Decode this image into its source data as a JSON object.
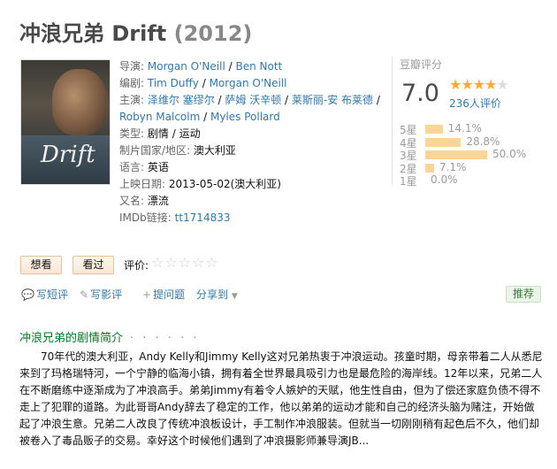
{
  "header": {
    "title": "冲浪兄弟 Drift",
    "year": "(2012)"
  },
  "poster": {
    "logo_text": "Drift"
  },
  "info": {
    "director_label": "导演:",
    "directors": [
      "Morgan O'Neill",
      "Ben Nott"
    ],
    "writer_label": "编剧:",
    "writers": [
      "Tim Duffy",
      "Morgan O'Neill"
    ],
    "cast_label": "主演:",
    "cast": [
      "泽维尔 塞缪尔",
      "萨姆 沃辛顿",
      "莱斯丽-安 布莱德",
      "Robyn Malcolm",
      "Myles Pollard"
    ],
    "genre_label": "类型:",
    "genres": [
      "剧情",
      "运动"
    ],
    "country_label": "制片国家/地区:",
    "country": "澳大利亚",
    "language_label": "语言:",
    "language": "英语",
    "release_label": "上映日期:",
    "release": "2013-05-02(澳大利亚)",
    "aka_label": "又名:",
    "aka": "漂流",
    "imdb_label": "IMDb链接:",
    "imdb": "tt1714833",
    "slash": " / "
  },
  "rating": {
    "header": "豆瓣评分",
    "score": "7.0",
    "stars_filled": "★★★★",
    "stars_empty": "★",
    "votes": "236人评价",
    "distribution": [
      {
        "label": "5星",
        "percent": 14.1,
        "text": "14.1%"
      },
      {
        "label": "4星",
        "percent": 28.8,
        "text": "28.8%"
      },
      {
        "label": "3星",
        "percent": 50.0,
        "text": "50.0%"
      },
      {
        "label": "2星",
        "percent": 7.1,
        "text": "7.1%"
      },
      {
        "label": "1星",
        "percent": 0.0,
        "text": "0.0%"
      }
    ]
  },
  "interest": {
    "want_label": "想看",
    "seen_label": "看过",
    "rate_label": "评价:",
    "rate_stars": "☆☆☆☆☆"
  },
  "actions": {
    "short_review": "写短评",
    "review": "写影评",
    "question": "提问题",
    "share": "分享到",
    "share_arrow": "▼",
    "recommend": "推荐"
  },
  "summary": {
    "title": "冲浪兄弟的剧情简介",
    "dots": "· · · · · ·",
    "text": "70年代的澳大利亚，Andy Kelly和Jimmy Kelly这对兄弟热衷于冲浪运动。孩童时期，母亲带着二人从悉尼来到了玛格瑞特河，一个宁静的临海小镇，拥有着全世界最具吸引力也是最危险的海岸线。12年以来，兄弟二人在不断磨练中逐渐成为了冲浪高手。弟弟Jimmy有着令人嫉妒的天赋，他生性自由，但为了偿还家庭负债不得不走上了犯罪的道路。为此哥哥Andy辞去了稳定的工作，他以弟弟的运动才能和自己的经济头脑为赌注，开始做起了冲浪生意。兄弟二人改良了传统冲浪板设计，手工制作冲浪服装。但就当一切刚刚稍有起色后不久，他们却被卷入了毒品贩子的交易。幸好这个时候他们遇到了冲浪摄影师兼导演JB..."
  }
}
